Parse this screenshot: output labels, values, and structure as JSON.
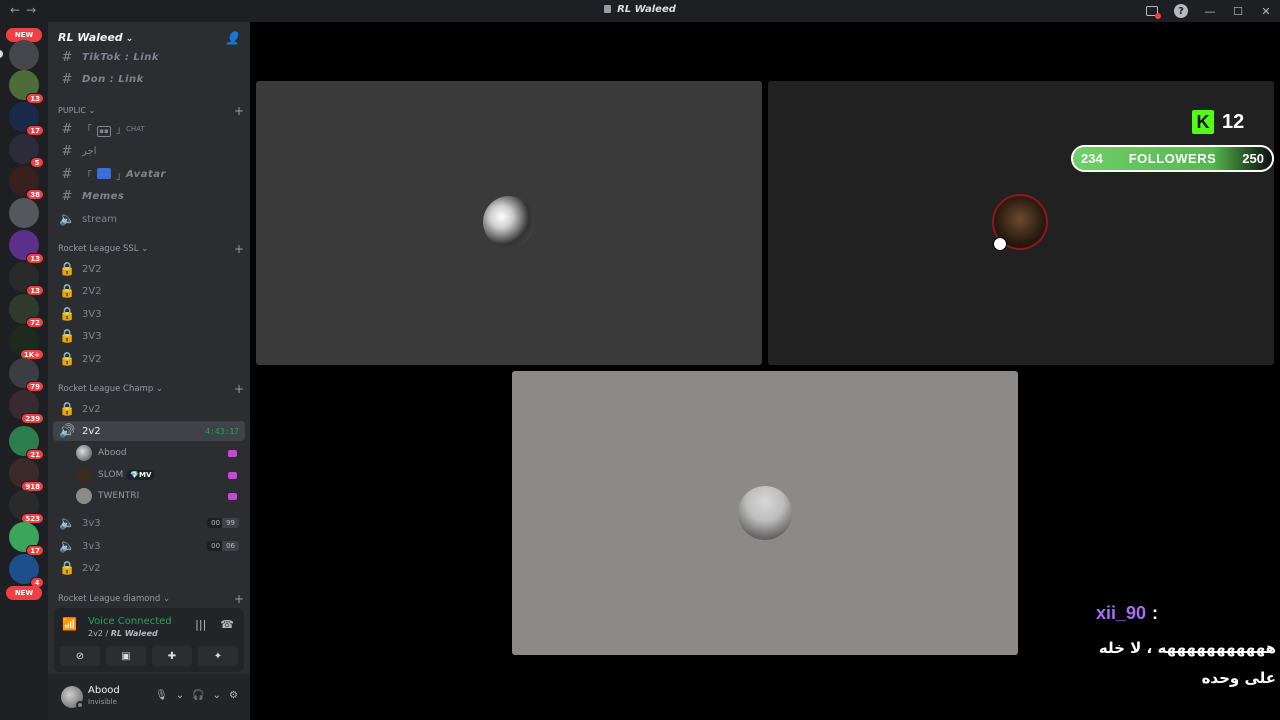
{
  "window": {
    "title": "RL Waleed",
    "nav_back": "←",
    "nav_forward": "→",
    "help": "?",
    "minimize": "—",
    "maximize": "☐",
    "close": "✕"
  },
  "rail": {
    "new_label": "NEW",
    "badges": [
      "13",
      "17",
      "5",
      "38",
      "13",
      "13",
      "72",
      "1K+",
      "79",
      "239",
      "21",
      "918",
      "523",
      "17",
      "4"
    ]
  },
  "server": {
    "name": "RL Waleed",
    "categories": [
      {
        "name": "",
        "channels": [
          {
            "type": "text",
            "name": "TikTok ꞉ Link",
            "style": "bold-italic"
          },
          {
            "type": "text",
            "name": "Don ꞉ Link",
            "style": "bold-italic"
          }
        ]
      },
      {
        "name": "PUPLIC",
        "channels": [
          {
            "type": "text",
            "name": "CHAT",
            "prefix": "「💬」"
          },
          {
            "type": "text",
            "name": "اجر"
          },
          {
            "type": "text",
            "name": "Avatar",
            "prefix": "「🔰」",
            "style": "bold-italic"
          },
          {
            "type": "text",
            "name": "Memes",
            "style": "bold-italic"
          },
          {
            "type": "voice",
            "name": "stream"
          }
        ]
      },
      {
        "name": "Rocket League SSL",
        "channels": [
          {
            "type": "locked",
            "name": "2V2"
          },
          {
            "type": "locked",
            "name": "2V2"
          },
          {
            "type": "locked",
            "name": "3V3"
          },
          {
            "type": "locked",
            "name": "3V3"
          },
          {
            "type": "locked",
            "name": "2V2"
          }
        ]
      },
      {
        "name": "Rocket League Champ",
        "channels": [
          {
            "type": "locked",
            "name": "2v2"
          },
          {
            "type": "voice-active",
            "name": "2v2",
            "timer": "4:43:17",
            "members": [
              {
                "name": "Abood"
              },
              {
                "name": "SLOM",
                "badge": "MV",
                "badge_icon": "💎"
              },
              {
                "name": "TWENTRI"
              }
            ]
          },
          {
            "type": "voice",
            "name": "3v3",
            "count": "00",
            "limit": "99"
          },
          {
            "type": "voice",
            "name": "3v3",
            "count": "00",
            "limit": "06"
          },
          {
            "type": "locked",
            "name": "2v2"
          }
        ]
      },
      {
        "name": "Rocket League diamond",
        "channels": []
      }
    ]
  },
  "voice_panel": {
    "status": "Voice Connected",
    "channel": "2v2",
    "server": "RL Waleed"
  },
  "user": {
    "name": "Abood",
    "status": "Invisible"
  },
  "overlay": {
    "kick_logo": "K",
    "kick_count": "12",
    "followers_current": "234",
    "followers_label": "FOLLOWERS",
    "followers_goal": "250",
    "followers_progress": 0.936,
    "chat_user": "xii_90",
    "chat_colon": ":",
    "chat_line1": "هههههههههههه ، لا خله",
    "chat_line2": "على وحده"
  },
  "colors": {
    "online_green": "#23a55a",
    "badge_red": "#f23f43",
    "kick_green": "#53fc18",
    "chat_purple": "#a86df3"
  }
}
